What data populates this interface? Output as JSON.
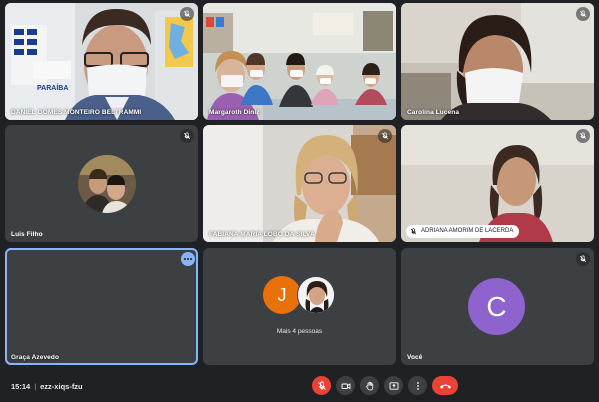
{
  "participants": [
    {
      "name": "DANIEL GOMES MONTEIRO BELTRAMMI",
      "wall_text": "PARAÍBA"
    },
    {
      "name": "Margaroth Diniz"
    },
    {
      "name": "Carolina Lucena"
    },
    {
      "name": "Luis Filho"
    },
    {
      "name": "FABIANA MARIA LOBO DA SILVA"
    },
    {
      "name": "ADRIANA AMORIM DE LACERDA"
    },
    {
      "name": "Graça Azevedo"
    },
    {
      "name": "Mais 4 pessoas",
      "avatar_letter": "J",
      "avatar_color": "#e8710a"
    },
    {
      "name": "Você",
      "avatar_letter": "C",
      "avatar_color": "#8e63ce"
    }
  ],
  "meeting": {
    "time": "15:14",
    "separator": "|",
    "code": "ezz-xiqs-fzu"
  },
  "controls": [
    {
      "name": "microphone-off",
      "icon": "mic-off-icon",
      "state": "off"
    },
    {
      "name": "camera",
      "icon": "camera-icon"
    },
    {
      "name": "raise-hand",
      "icon": "hand-icon"
    },
    {
      "name": "present-screen",
      "icon": "present-icon"
    },
    {
      "name": "more-options",
      "icon": "more-vert-icon"
    },
    {
      "name": "leave-call",
      "icon": "call-end-icon"
    }
  ],
  "colors": {
    "background": "#202124",
    "tile": "#3c4043",
    "accent": "#8ab4f8",
    "danger": "#ea4335"
  }
}
